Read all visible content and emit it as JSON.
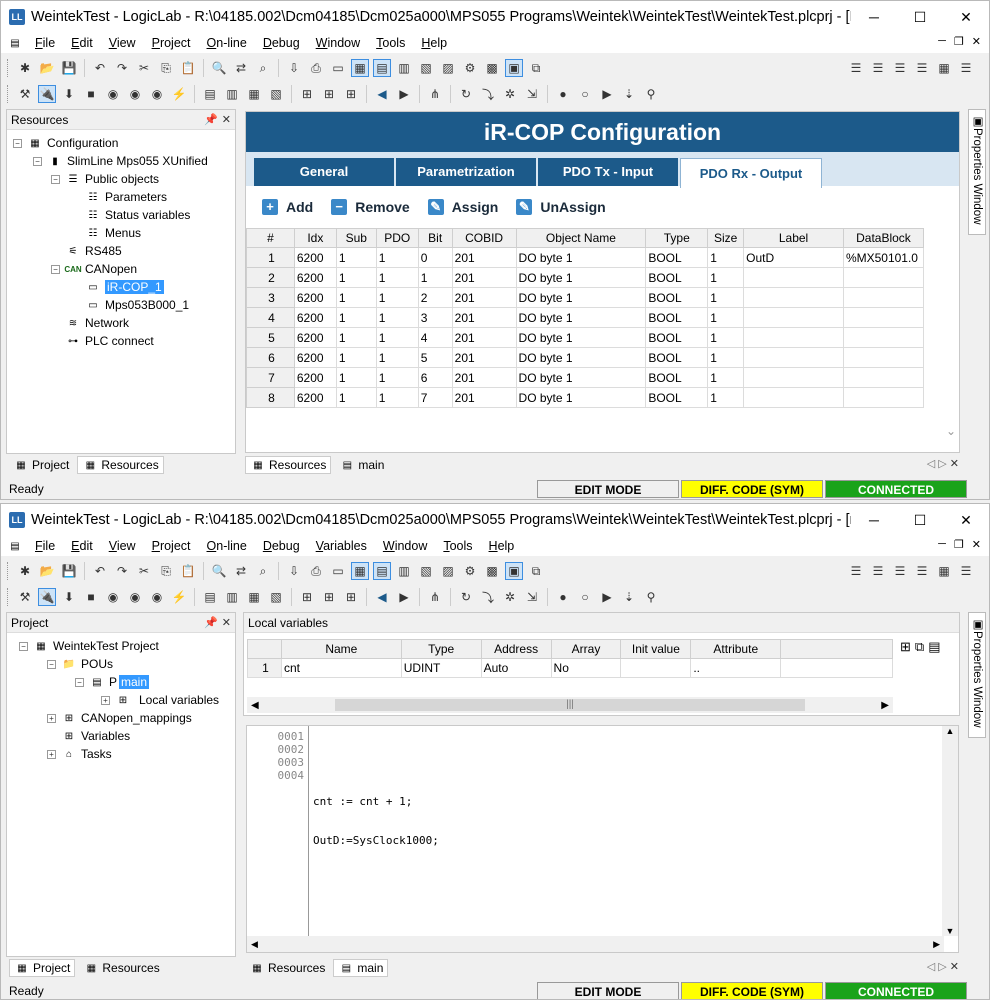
{
  "w1": {
    "title": "WeintekTest - LogicLab - R:\\04185.002\\Dcm04185\\Dcm025a000\\MPS055 Programs\\Weintek\\WeintekTest\\WeintekTest.plcprj - [Resou…",
    "menu": [
      "File",
      "Edit",
      "View",
      "Project",
      "On-line",
      "Debug",
      "Window",
      "Tools",
      "Help"
    ],
    "resources_title": "Resources",
    "tree": {
      "configuration": "Configuration",
      "slimline": "SlimLine Mps055 XUnified",
      "public_objects": "Public objects",
      "parameters": "Parameters",
      "status_variables": "Status variables",
      "menus": "Menus",
      "rs485": "RS485",
      "canopen": "CANopen",
      "ircop": "iR-COP_1",
      "mps053": "Mps053B000_1",
      "network": "Network",
      "plc_connect": "PLC connect",
      "can_badge": "CAN"
    },
    "left_tabs": [
      "Project",
      "Resources"
    ],
    "doc_tabs": [
      "Resources",
      "main"
    ],
    "status": {
      "ready": "Ready",
      "mode": "EDIT MODE",
      "diff": "DIFF. CODE (SYM)",
      "conn": "CONNECTED"
    },
    "props": "Properties Window",
    "cop": {
      "title": "iR-COP Configuration",
      "tabs": [
        "General",
        "Parametrization",
        "PDO Tx - Input",
        "PDO Rx - Output"
      ],
      "actions": [
        "Add",
        "Remove",
        "Assign",
        "UnAssign"
      ],
      "columns": [
        "#",
        "Idx",
        "Sub",
        "PDO",
        "Bit",
        "COBID",
        "Object Name",
        "Type",
        "Size",
        "Label",
        "DataBlock"
      ],
      "rows": [
        [
          "1",
          "6200",
          "1",
          "1",
          "0",
          "201",
          "DO byte 1",
          "BOOL",
          "1",
          "OutD",
          "%MX50101.0"
        ],
        [
          "2",
          "6200",
          "1",
          "1",
          "1",
          "201",
          "DO byte 1",
          "BOOL",
          "1",
          "",
          ""
        ],
        [
          "3",
          "6200",
          "1",
          "1",
          "2",
          "201",
          "DO byte 1",
          "BOOL",
          "1",
          "",
          ""
        ],
        [
          "4",
          "6200",
          "1",
          "1",
          "3",
          "201",
          "DO byte 1",
          "BOOL",
          "1",
          "",
          ""
        ],
        [
          "5",
          "6200",
          "1",
          "1",
          "4",
          "201",
          "DO byte 1",
          "BOOL",
          "1",
          "",
          ""
        ],
        [
          "6",
          "6200",
          "1",
          "1",
          "5",
          "201",
          "DO byte 1",
          "BOOL",
          "1",
          "",
          ""
        ],
        [
          "7",
          "6200",
          "1",
          "1",
          "6",
          "201",
          "DO byte 1",
          "BOOL",
          "1",
          "",
          ""
        ],
        [
          "8",
          "6200",
          "1",
          "1",
          "7",
          "201",
          "DO byte 1",
          "BOOL",
          "1",
          "",
          ""
        ]
      ]
    }
  },
  "w2": {
    "title": "WeintekTest - LogicLab - R:\\04185.002\\Dcm04185\\Dcm025a000\\MPS055 Programs\\Weintek\\WeintekTest\\WeintekTest.plcprj - [main]",
    "menu": [
      "File",
      "Edit",
      "View",
      "Project",
      "On-line",
      "Debug",
      "Variables",
      "Window",
      "Tools",
      "Help"
    ],
    "project_title": "Project",
    "tree": {
      "root": "WeintekTest Project",
      "pous": "POUs",
      "main_prefix": "P",
      "main": "main",
      "local_vars": "Local variables",
      "canopen_map": "CANopen_mappings",
      "variables": "Variables",
      "tasks": "Tasks"
    },
    "local_vars_title": "Local variables",
    "lv_columns": [
      "Name",
      "Type",
      "Address",
      "Array",
      "Init value",
      "Attribute"
    ],
    "lv_rows": [
      [
        "1",
        "cnt",
        "UDINT",
        "Auto",
        "No",
        "",
        ".."
      ]
    ],
    "code_lines": [
      "0001",
      "0002",
      "0003",
      "0004"
    ],
    "code_text": [
      "",
      "cnt := cnt + 1;",
      "OutD:=SysClock1000;",
      ""
    ],
    "left_tabs": [
      "Project",
      "Resources"
    ],
    "doc_tabs": [
      "Resources",
      "main"
    ],
    "status": {
      "ready": "Ready",
      "mode": "EDIT MODE",
      "diff": "DIFF. CODE (SYM)",
      "conn": "CONNECTED"
    },
    "props": "Properties Window"
  },
  "colors": {
    "accent": "#1c5a8a",
    "diff": "#ffff00",
    "connected": "#1aa31a",
    "selection": "#3399ff"
  }
}
